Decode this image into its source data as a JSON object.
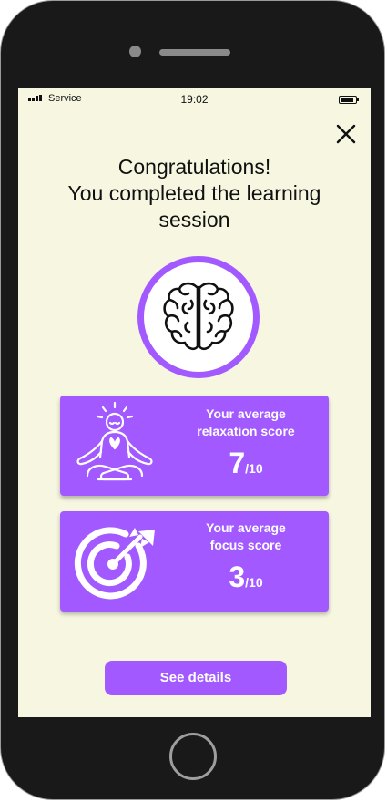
{
  "status": {
    "carrier": "Service",
    "time": "19:02"
  },
  "header": {
    "title_lines": [
      "Congratulations!",
      "You completed the learning",
      "session"
    ]
  },
  "icons": {
    "close": "close-icon",
    "hero": "brain-icon",
    "relaxation": "meditation-icon",
    "focus": "target-icon"
  },
  "cards": {
    "relaxation": {
      "label_lines": [
        "Your average",
        "relaxation score"
      ],
      "score": "7",
      "max": "/10"
    },
    "focus": {
      "label_lines": [
        "Your average",
        "focus score"
      ],
      "score": "3",
      "max": "/10"
    }
  },
  "actions": {
    "details_label": "See details"
  },
  "colors": {
    "accent": "#a259ff",
    "screen_background": "#f6f6e1",
    "device_frame": "#191919"
  }
}
